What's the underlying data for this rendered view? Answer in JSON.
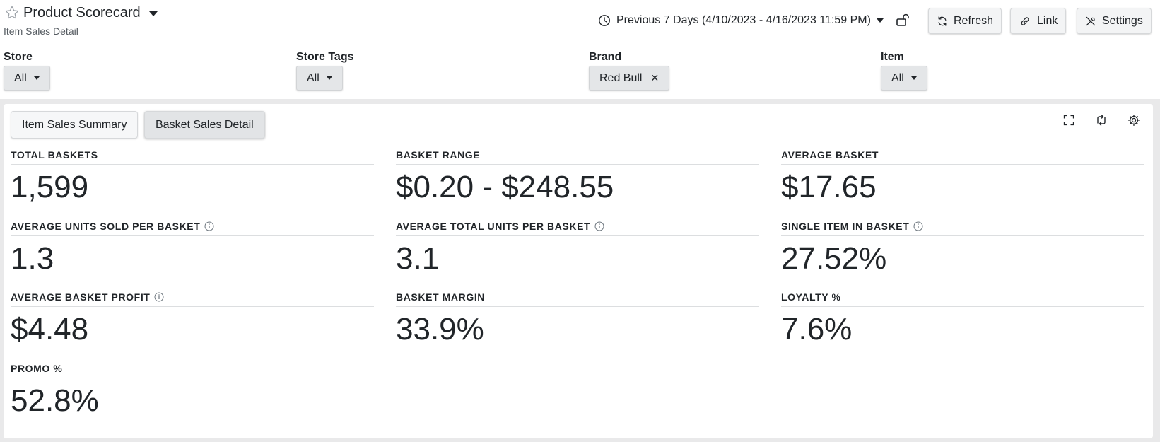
{
  "header": {
    "title": "Product Scorecard",
    "subtitle": "Item Sales Detail",
    "date_range": "Previous 7 Days (4/10/2023 - 4/16/2023 11:59 PM)",
    "buttons": {
      "refresh": "Refresh",
      "link": "Link",
      "settings": "Settings"
    }
  },
  "filters": [
    {
      "label": "Store",
      "value": "All"
    },
    {
      "label": "Store Tags",
      "value": "All"
    },
    {
      "label": "Brand",
      "value": "Red Bull"
    },
    {
      "label": "Item",
      "value": "All"
    }
  ],
  "tabs": [
    {
      "label": "Item Sales Summary"
    },
    {
      "label": "Basket Sales Detail"
    }
  ],
  "active_tab": "Basket Sales Detail",
  "metrics": [
    {
      "label": "TOTAL BASKETS",
      "value": "1,599",
      "has_info": false
    },
    {
      "label": "BASKET RANGE",
      "value": "$0.20 - $248.55",
      "has_info": false
    },
    {
      "label": "AVERAGE BASKET",
      "value": "$17.65",
      "has_info": false
    },
    {
      "label": "AVERAGE UNITS SOLD PER BASKET",
      "value": "1.3",
      "has_info": true
    },
    {
      "label": "AVERAGE TOTAL UNITS PER BASKET",
      "value": "3.1",
      "has_info": true
    },
    {
      "label": "SINGLE ITEM IN BASKET",
      "value": "27.52%",
      "has_info": true
    },
    {
      "label": "AVERAGE BASKET PROFIT",
      "value": "$4.48",
      "has_info": true
    },
    {
      "label": "BASKET MARGIN",
      "value": "33.9%",
      "has_info": false
    },
    {
      "label": "LOYALTY %",
      "value": "7.6%",
      "has_info": false
    },
    {
      "label": "PROMO %",
      "value": "52.8%",
      "has_info": false
    }
  ],
  "icons": {
    "favorite": "star-outline-icon",
    "date": "clock-icon",
    "lock": "unlock-icon",
    "refresh": "refresh-icon",
    "link": "link-icon",
    "settings": "tools-icon",
    "fullscreen": "expand-icon",
    "sync": "sync-icon",
    "card_settings": "gear-icon",
    "info": "info-icon"
  },
  "colors": {
    "page_background": "#e9e9ea",
    "text": "#212529",
    "button_background": "#f3f4f5",
    "active_tab_background": "#e2e4e6"
  }
}
